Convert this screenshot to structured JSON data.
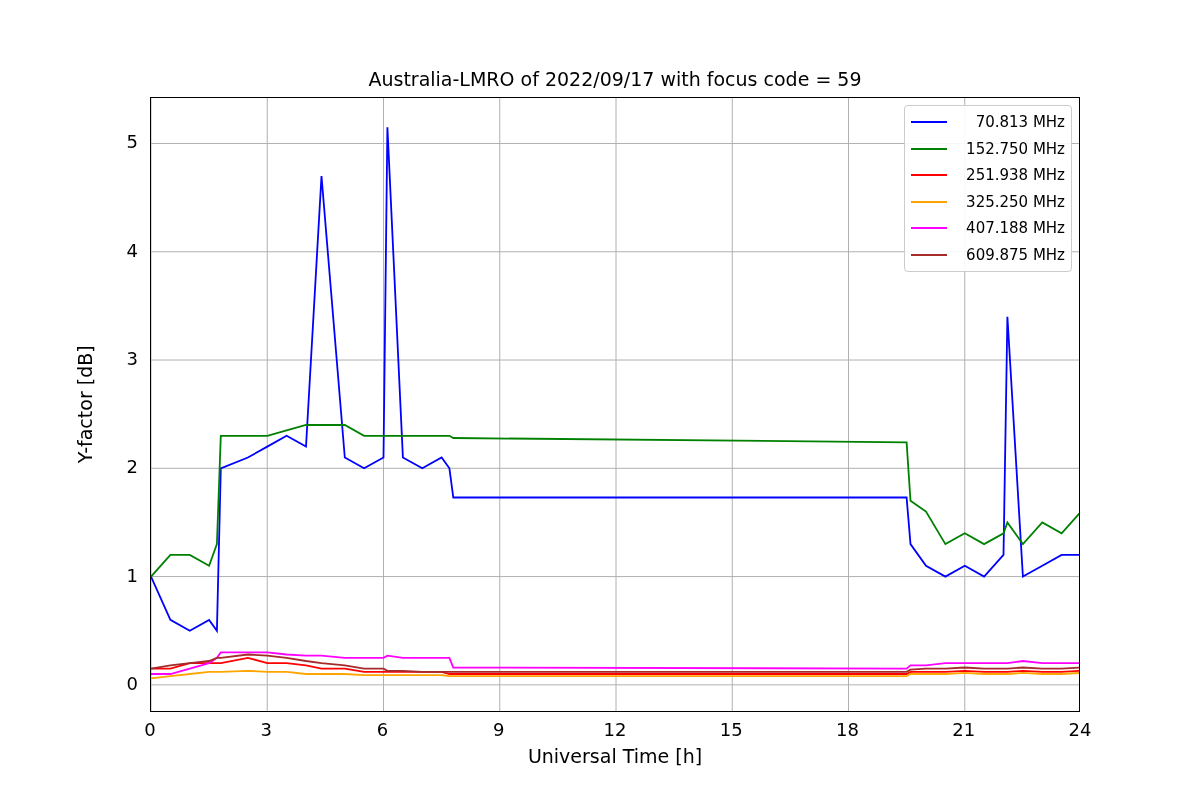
{
  "chart_data": {
    "type": "line",
    "title": "Australia-LMRO of 2022/09/17 with focus code = 59",
    "xlabel": "Universal Time [h]",
    "ylabel": "Y-factor [dB]",
    "x": [
      0,
      0.5,
      1,
      1.5,
      1.7,
      1.8,
      2.5,
      3,
      3.5,
      4,
      4.4,
      5,
      5.5,
      6,
      6.1,
      6.5,
      7,
      7.5,
      7.7,
      7.8,
      19.5,
      19.6,
      20,
      20.5,
      21,
      21.5,
      22,
      22.1,
      22.5,
      23,
      23.5,
      24
    ],
    "series": [
      {
        "name": "70.813 MHz",
        "color": "#0000ff",
        "values": [
          1.0,
          0.6,
          0.5,
          0.6,
          0.5,
          2.0,
          2.1,
          2.2,
          2.3,
          2.2,
          4.7,
          2.1,
          2.0,
          2.1,
          5.15,
          2.1,
          2.0,
          2.1,
          2.0,
          1.73,
          1.73,
          1.3,
          1.1,
          1.0,
          1.1,
          1.0,
          1.2,
          3.4,
          1.0,
          1.1,
          1.2,
          1.2
        ]
      },
      {
        "name": "152.750 MHz",
        "color": "#008000",
        "values": [
          1.0,
          1.2,
          1.2,
          1.1,
          1.3,
          2.3,
          2.3,
          2.3,
          2.35,
          2.4,
          2.4,
          2.4,
          2.3,
          2.3,
          2.3,
          2.3,
          2.3,
          2.3,
          2.3,
          2.28,
          2.24,
          1.7,
          1.6,
          1.3,
          1.4,
          1.3,
          1.4,
          1.5,
          1.3,
          1.5,
          1.4,
          1.6
        ]
      },
      {
        "name": "251.938 MHz",
        "color": "#ff0000",
        "values": [
          0.15,
          0.15,
          0.2,
          0.2,
          0.2,
          0.2,
          0.25,
          0.2,
          0.2,
          0.18,
          0.15,
          0.15,
          0.12,
          0.12,
          0.12,
          0.12,
          0.12,
          0.12,
          0.1,
          0.1,
          0.1,
          0.12,
          0.12,
          0.12,
          0.13,
          0.12,
          0.12,
          0.12,
          0.13,
          0.12,
          0.12,
          0.13
        ]
      },
      {
        "name": "325.250 MHz",
        "color": "#ffa500",
        "values": [
          0.06,
          0.08,
          0.1,
          0.12,
          0.12,
          0.12,
          0.13,
          0.12,
          0.12,
          0.1,
          0.1,
          0.1,
          0.09,
          0.09,
          0.09,
          0.09,
          0.09,
          0.09,
          0.08,
          0.08,
          0.08,
          0.1,
          0.1,
          0.1,
          0.11,
          0.1,
          0.1,
          0.1,
          0.11,
          0.1,
          0.1,
          0.11
        ]
      },
      {
        "name": "407.188 MHz",
        "color": "#ff00ff",
        "values": [
          0.1,
          0.1,
          0.15,
          0.2,
          0.25,
          0.3,
          0.3,
          0.3,
          0.28,
          0.27,
          0.27,
          0.25,
          0.25,
          0.25,
          0.27,
          0.25,
          0.25,
          0.25,
          0.25,
          0.16,
          0.15,
          0.18,
          0.18,
          0.2,
          0.2,
          0.2,
          0.2,
          0.2,
          0.22,
          0.2,
          0.2,
          0.2
        ]
      },
      {
        "name": "609.875 MHz",
        "color": "#a52a2a",
        "values": [
          0.15,
          0.18,
          0.2,
          0.22,
          0.25,
          0.25,
          0.28,
          0.27,
          0.25,
          0.22,
          0.2,
          0.18,
          0.15,
          0.15,
          0.13,
          0.13,
          0.12,
          0.12,
          0.12,
          0.12,
          0.12,
          0.14,
          0.15,
          0.15,
          0.16,
          0.15,
          0.15,
          0.15,
          0.16,
          0.15,
          0.15,
          0.16
        ]
      }
    ],
    "xlim": [
      0,
      24
    ],
    "ylim": [
      -0.26,
      5.42
    ],
    "xticks": [
      0,
      3,
      6,
      9,
      12,
      15,
      18,
      21,
      24
    ],
    "yticks": [
      0,
      1,
      2,
      3,
      4,
      5
    ],
    "grid": true,
    "legend": true
  }
}
